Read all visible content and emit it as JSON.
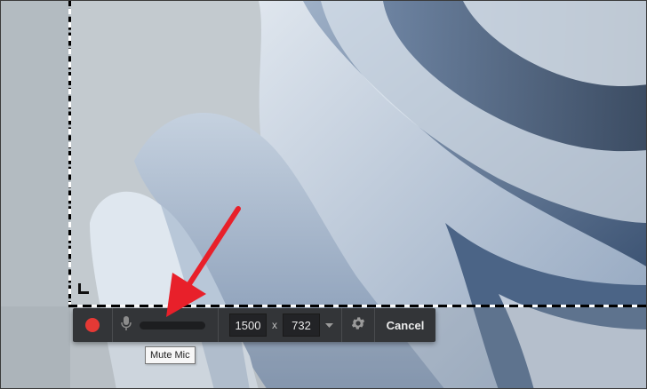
{
  "toolbar": {
    "record_icon": "record-dot-icon",
    "record_color": "#e53935",
    "mic_icon": "microphone-icon",
    "mic_level": 0,
    "width_value": "1500",
    "times_symbol": "x",
    "height_value": "732",
    "dropdown_icon": "caret-down-icon",
    "settings_icon": "gear-icon",
    "cancel_label": "Cancel"
  },
  "tooltip": {
    "text": "Mute Mic"
  },
  "annotation": {
    "arrow_color": "#e8202a"
  }
}
